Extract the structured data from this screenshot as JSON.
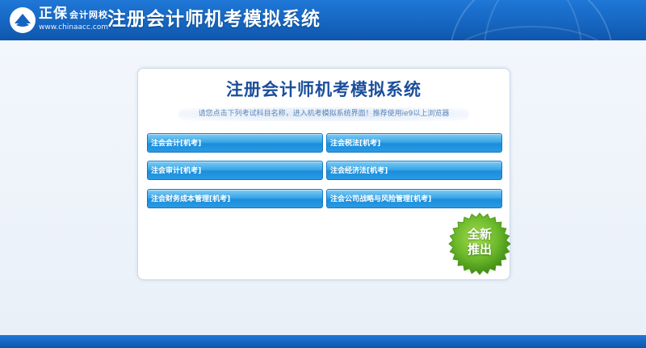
{
  "header": {
    "logo_name": "正保",
    "logo_sub": "会计网校",
    "logo_url": "www.chinaacc.com",
    "title": "注册会计师机考模拟系统"
  },
  "panel": {
    "title": "注册会计师机考模拟系统",
    "subtitle": "请您点击下列考试科目名称，进入机考模拟系统界面！推荐使用ie9以上浏览器"
  },
  "exams": [
    {
      "label": "注会会计[机考]"
    },
    {
      "label": "注会税法[机考]"
    },
    {
      "label": "注会审计[机考]"
    },
    {
      "label": "注会经济法[机考]"
    },
    {
      "label": "注会财务成本管理[机考]"
    },
    {
      "label": "注会公司战略与风险管理[机考]"
    }
  ],
  "badge": {
    "line1": "全新",
    "line2": "推出"
  },
  "colors": {
    "header_blue": "#1565c0",
    "button_blue": "#2a9ae3",
    "title_blue": "#1b4f9c",
    "badge_green": "#6ab82a"
  }
}
